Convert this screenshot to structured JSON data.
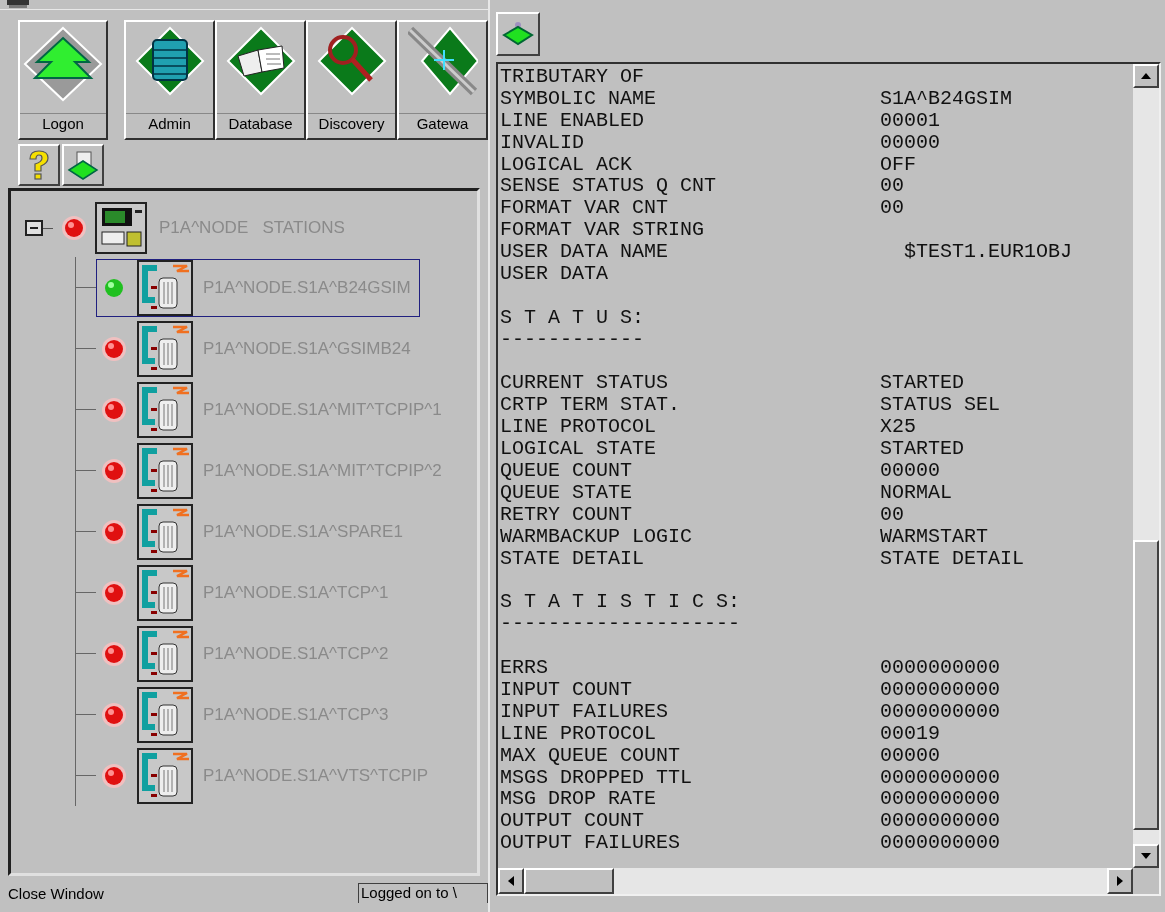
{
  "toolbar": {
    "buttons": [
      {
        "label": "Logon",
        "kind": "logon"
      },
      {
        "label": "Admin",
        "kind": "admin"
      },
      {
        "label": "Database",
        "kind": "database"
      },
      {
        "label": "Discovery",
        "kind": "discovery"
      },
      {
        "label": "Gatewa",
        "kind": "gateway"
      }
    ]
  },
  "tree": {
    "label": "P1A^NODE   STATIONS",
    "up": false,
    "expanded": true,
    "children": [
      {
        "label": "P1A^NODE.S1A^B24GSIM",
        "up": true,
        "selected": true
      },
      {
        "label": "P1A^NODE.S1A^GSIMB24",
        "up": false,
        "selected": false
      },
      {
        "label": "P1A^NODE.S1A^MIT^TCPIP^1",
        "up": false,
        "selected": false
      },
      {
        "label": "P1A^NODE.S1A^MIT^TCPIP^2",
        "up": false,
        "selected": false
      },
      {
        "label": "P1A^NODE.S1A^SPARE1",
        "up": false,
        "selected": false
      },
      {
        "label": "P1A^NODE.S1A^TCP^1",
        "up": false,
        "selected": false
      },
      {
        "label": "P1A^NODE.S1A^TCP^2",
        "up": false,
        "selected": false
      },
      {
        "label": "P1A^NODE.S1A^TCP^3",
        "up": false,
        "selected": false
      },
      {
        "label": "P1A^NODE.S1A^VTS^TCPIP",
        "up": false,
        "selected": false
      }
    ]
  },
  "status_bar": {
    "message": "Close Window",
    "field": "Logged on to \\"
  },
  "details": {
    "lines": [
      {
        "kind": "field",
        "label": "TRIBUTARY OF"
      },
      {
        "kind": "field",
        "label": "SYMBOLIC NAME",
        "value": "S1A^B24GSIM"
      },
      {
        "kind": "field",
        "label": "LINE ENABLED",
        "value": "00001"
      },
      {
        "kind": "field",
        "label": "INVALID",
        "value": "00000"
      },
      {
        "kind": "field",
        "label": "LOGICAL ACK",
        "value": "OFF"
      },
      {
        "kind": "field",
        "label": "SENSE STATUS Q CNT",
        "value": "00"
      },
      {
        "kind": "field",
        "label": "FORMAT VAR CNT",
        "value": "00"
      },
      {
        "kind": "field",
        "label": "FORMAT VAR STRING"
      },
      {
        "kind": "field",
        "label": "USER DATA NAME",
        "value": "  $TEST1.EUR1OBJ"
      },
      {
        "kind": "field",
        "label": "USER DATA"
      },
      {
        "kind": "blank"
      },
      {
        "kind": "heading",
        "text": "S T A T U S:"
      },
      {
        "kind": "rule",
        "text": "------------"
      },
      {
        "kind": "blank"
      },
      {
        "kind": "field",
        "label": "CURRENT STATUS",
        "value": "STARTED"
      },
      {
        "kind": "field",
        "label": "CRTP TERM STAT.",
        "value": "STATUS SEL"
      },
      {
        "kind": "field",
        "label": "LINE PROTOCOL",
        "value": "X25"
      },
      {
        "kind": "field",
        "label": "LOGICAL STATE",
        "value": "STARTED"
      },
      {
        "kind": "field",
        "label": "QUEUE COUNT",
        "value": "00000"
      },
      {
        "kind": "field",
        "label": "QUEUE STATE",
        "value": "NORMAL"
      },
      {
        "kind": "field",
        "label": "RETRY COUNT",
        "value": "00"
      },
      {
        "kind": "field",
        "label": "WARMBACKUP LOGIC",
        "value": "WARMSTART"
      },
      {
        "kind": "field",
        "label": "STATE DETAIL",
        "value": "STATE DETAIL"
      },
      {
        "kind": "blank"
      },
      {
        "kind": "heading",
        "text": "S T A T I S T I C S:"
      },
      {
        "kind": "rule",
        "text": "--------------------"
      },
      {
        "kind": "blank"
      },
      {
        "kind": "field",
        "label": "ERRS",
        "value": "0000000000"
      },
      {
        "kind": "field",
        "label": "INPUT COUNT",
        "value": "0000000000"
      },
      {
        "kind": "field",
        "label": "INPUT FAILURES",
        "value": "0000000000"
      },
      {
        "kind": "field",
        "label": "LINE PROTOCOL",
        "value": "00019"
      },
      {
        "kind": "field",
        "label": "MAX QUEUE COUNT",
        "value": "00000"
      },
      {
        "kind": "field",
        "label": "MSGS DROPPED TTL",
        "value": "0000000000"
      },
      {
        "kind": "field",
        "label": "MSG DROP RATE",
        "value": "0000000000"
      },
      {
        "kind": "field",
        "label": "OUTPUT COUNT",
        "value": "0000000000"
      },
      {
        "kind": "field",
        "label": "OUTPUT FAILURES",
        "value": "0000000000"
      }
    ]
  }
}
